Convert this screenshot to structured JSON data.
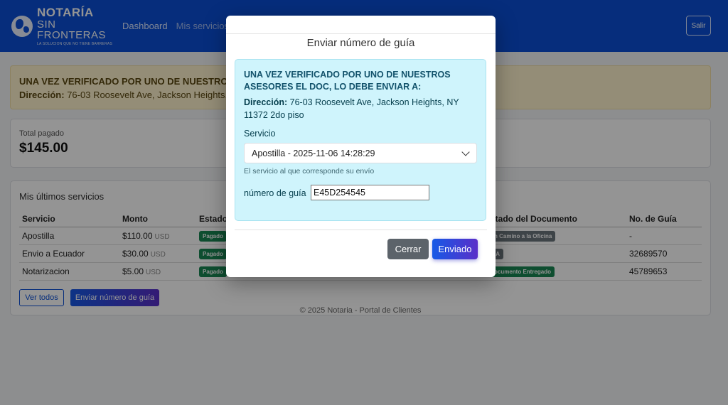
{
  "navbar": {
    "brand": {
      "line1": "NOTARÍA",
      "line2": "SIN FRONTERAS",
      "tagline": "LA SOLUCION QUE NO TIENE BARRERAS"
    },
    "links": [
      "Dashboard",
      "Mis servicios"
    ],
    "logout_label": "Salir"
  },
  "alert": {
    "title": "UNA VEZ VERIFICADO POR UNO DE NUESTROS A",
    "address_label": "Dirección:",
    "address_value": "76-03 Roosevelt Ave, Jackson Heights,"
  },
  "totals": {
    "label": "Total pagado",
    "value": "$145.00"
  },
  "services": {
    "title": "Mis últimos servicios",
    "headers": [
      "Servicio",
      "Monto",
      "Estado",
      "stado del Documento",
      "No. de Guía"
    ],
    "currency": "USD",
    "rows": [
      {
        "servicio": "Apostilla",
        "monto": "$110.00",
        "estado": "Pagado",
        "documento": "n Camino a la Oficina",
        "guia": "-"
      },
      {
        "servicio": "Envio a Ecuador",
        "monto": "$30.00",
        "estado": "Pagado",
        "documento": "/A",
        "guia": "32689570"
      },
      {
        "servicio": "Notarizacion",
        "monto": "$5.00",
        "estado": "Pagado",
        "documento": "ocumento Entregado",
        "guia": "45789653"
      }
    ],
    "view_all_label": "Ver todos",
    "send_guide_label": "Enviar número de guía"
  },
  "footer": "© 2025 Notaria - Portal de Clientes",
  "modal": {
    "title": "Enviar número de guía",
    "info_title": "UNA VEZ VERIFICADO POR UNO DE NUESTROS ASESORES EL DOC, LO DEBE ENVIAR A:",
    "address_label": "Dirección:",
    "address_value": "76-03 Roosevelt Ave, Jackson Heights, NY 11372 2do piso",
    "service_label": "Servicio",
    "service_selected": "Apostilla - 2025-11-06 14:28:29",
    "service_help": "El servicio al que corresponde su envío",
    "guide_label": "número de guía",
    "guide_value": "E45D254545",
    "cancel_label": "Cerrar",
    "submit_label": "Enviado"
  },
  "colors": {
    "navbar": "#0b4fd6",
    "info_box": "#cff4fc",
    "alert": "#fff3cd",
    "badge_green": "#198754",
    "badge_grey": "#6c757d"
  }
}
